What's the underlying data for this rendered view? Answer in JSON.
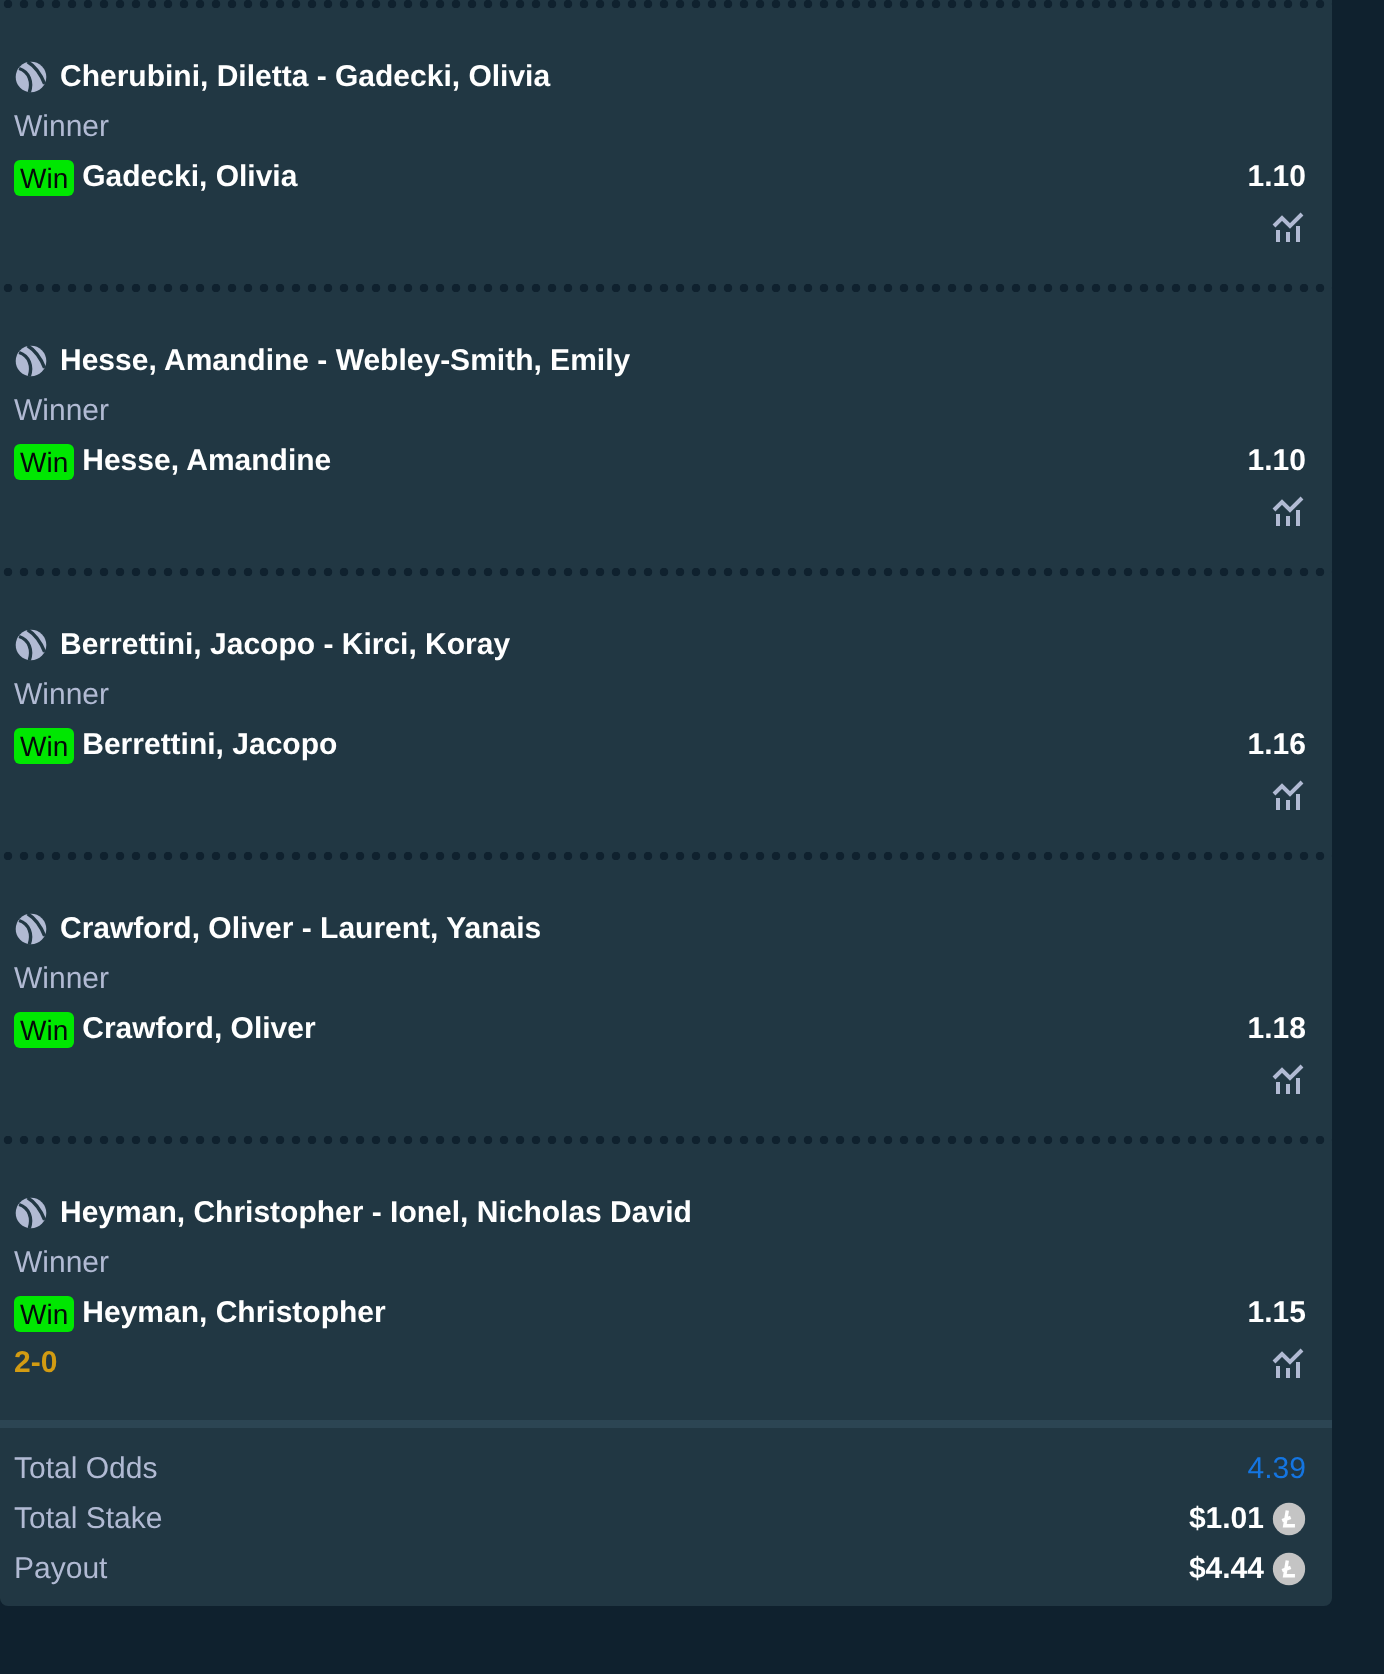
{
  "legs": [
    {
      "event": "Cherubini, Diletta - Gadecki, Olivia",
      "market": "Winner",
      "badge": "Win",
      "outcome": "Gadecki, Olivia",
      "odds": "1.10"
    },
    {
      "event": "Hesse, Amandine - Webley-Smith, Emily",
      "market": "Winner",
      "badge": "Win",
      "outcome": "Hesse, Amandine",
      "odds": "1.10"
    },
    {
      "event": "Berrettini, Jacopo - Kirci, Koray",
      "market": "Winner",
      "badge": "Win",
      "outcome": "Berrettini, Jacopo",
      "odds": "1.16"
    },
    {
      "event": "Crawford, Oliver - Laurent, Yanais",
      "market": "Winner",
      "badge": "Win",
      "outcome": "Crawford, Oliver",
      "odds": "1.18"
    },
    {
      "event": "Heyman, Christopher - Ionel, Nicholas David",
      "market": "Winner",
      "badge": "Win",
      "outcome": "Heyman, Christopher",
      "odds": "1.15",
      "score": "2-0"
    }
  ],
  "totals": [
    {
      "kind": "odds",
      "label": "Total Odds",
      "value": "4.39"
    },
    {
      "kind": "amount",
      "label": "Total Stake",
      "value": "$1.01"
    },
    {
      "kind": "amount",
      "label": "Payout",
      "value": "$4.44"
    }
  ]
}
